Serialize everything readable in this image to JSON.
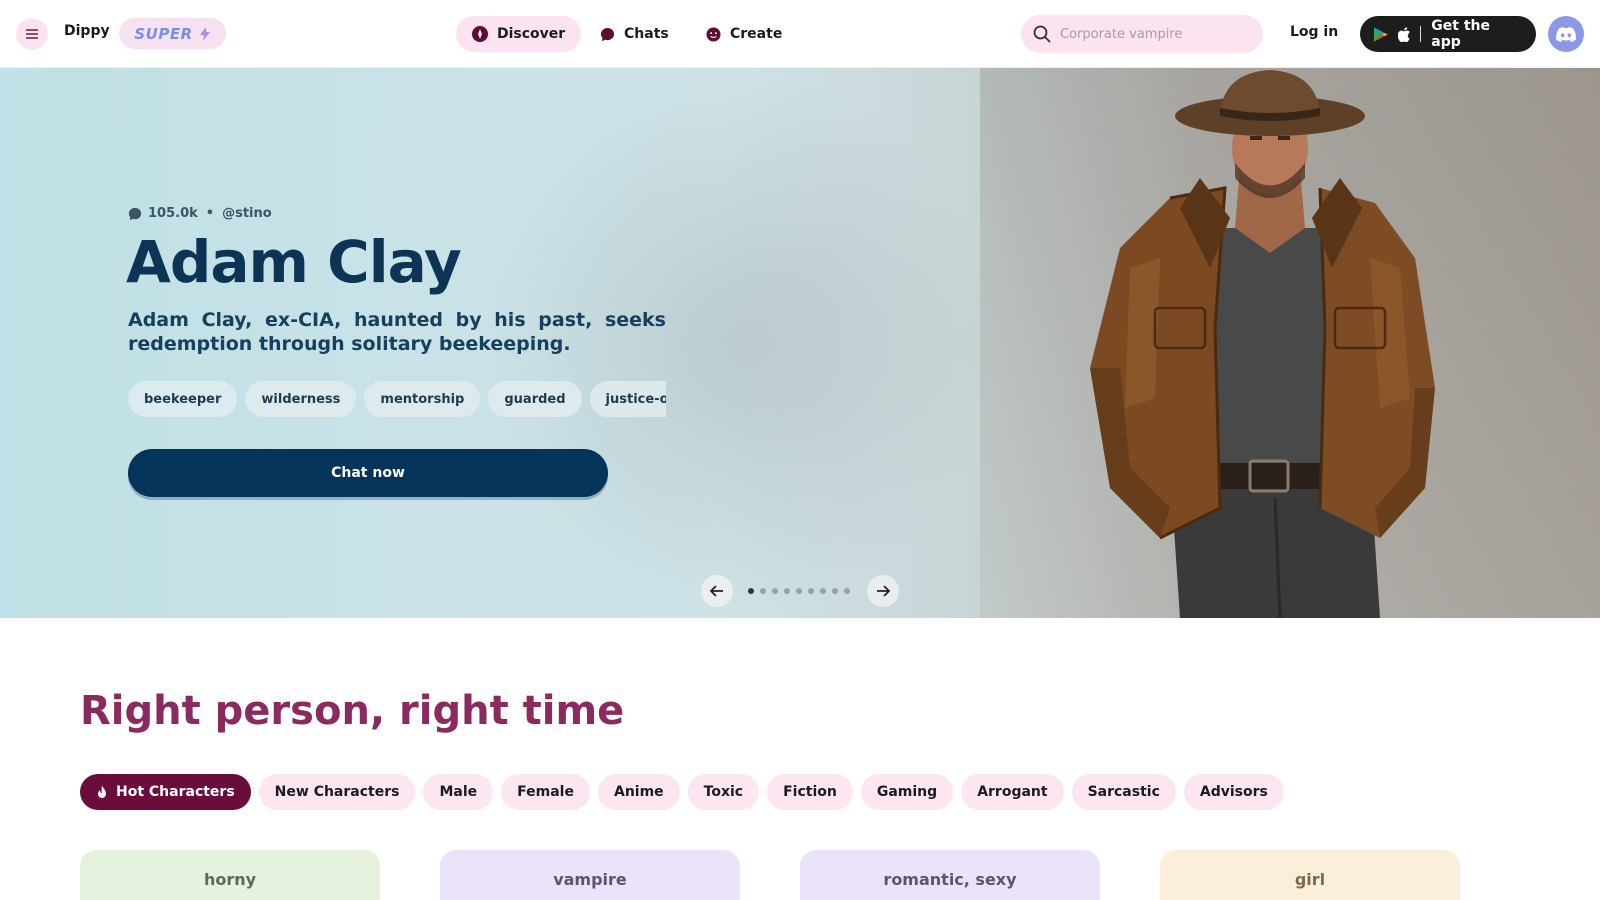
{
  "nav": {
    "brand": "Dippy",
    "super_label": "SUPER",
    "tabs": [
      {
        "label": "Discover",
        "icon": "compass-icon",
        "active": true
      },
      {
        "label": "Chats",
        "icon": "chat-bubble-icon",
        "active": false
      },
      {
        "label": "Create",
        "icon": "face-icon",
        "active": false
      }
    ],
    "search": {
      "placeholder": "Corporate vampire",
      "value": ""
    },
    "login_label": "Log in",
    "get_app_label": "Get the app"
  },
  "hero": {
    "chat_count": "105.0k",
    "separator": "•",
    "creator": "@stino",
    "title": "Adam Clay",
    "description": "Adam Clay, ex-CIA, haunted by his past, seeks redemption through solitary beekeeping.",
    "tags": [
      "beekeeper",
      "wilderness",
      "mentorship",
      "guarded",
      "justice-oriented"
    ],
    "cta_label": "Chat now",
    "carousel": {
      "total": 9,
      "active_index": 0
    }
  },
  "section": {
    "title": "Right person, right time",
    "categories": [
      {
        "label": "Hot Characters",
        "active": true,
        "icon": "flame-icon"
      },
      {
        "label": "New Characters",
        "active": false
      },
      {
        "label": "Male",
        "active": false
      },
      {
        "label": "Female",
        "active": false
      },
      {
        "label": "Anime",
        "active": false
      },
      {
        "label": "Toxic",
        "active": false
      },
      {
        "label": "Fiction",
        "active": false
      },
      {
        "label": "Gaming",
        "active": false
      },
      {
        "label": "Arrogant",
        "active": false
      },
      {
        "label": "Sarcastic",
        "active": false
      },
      {
        "label": "Advisors",
        "active": false
      }
    ],
    "cards": [
      {
        "label": "horny",
        "bg": "#e6f2de",
        "color": "#5b6b55"
      },
      {
        "label": "vampire",
        "bg": "#ebe3fa",
        "color": "#5c5570"
      },
      {
        "label": "romantic, sexy",
        "bg": "#ebe3fa",
        "color": "#5c5570"
      },
      {
        "label": "girl",
        "bg": "#fcefd9",
        "color": "#7a6a50"
      }
    ]
  },
  "colors": {
    "accent_pink": "#fbe3f1",
    "hero_navy": "#05345a",
    "section_title": "#8b2a5e",
    "active_category": "#6b0d3c"
  }
}
